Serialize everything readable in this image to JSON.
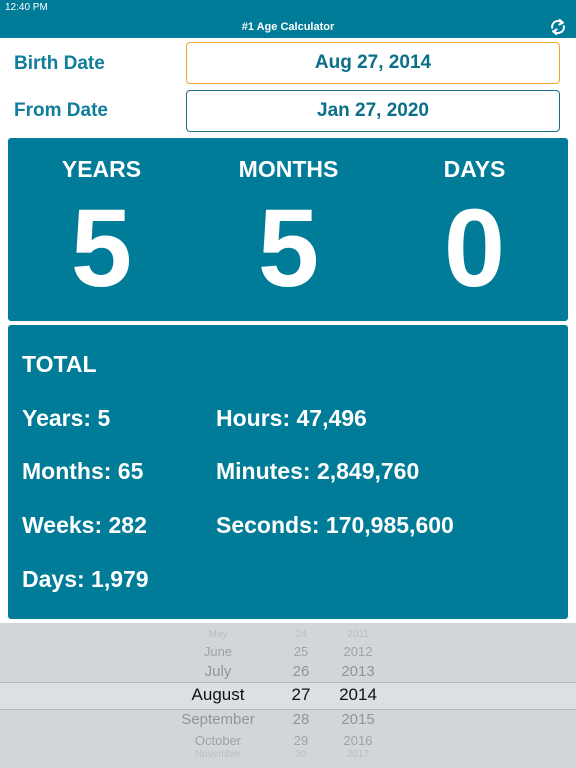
{
  "status_bar": {
    "time": "12:40 PM"
  },
  "nav": {
    "title": "#1 Age Calculator",
    "refresh_icon": "refresh-icon"
  },
  "birth": {
    "label": "Birth Date",
    "value": "Aug 27, 2014"
  },
  "from": {
    "label": "From Date",
    "value": "Jan 27, 2020"
  },
  "age": {
    "years_label": "YEARS",
    "years": "5",
    "months_label": "MONTHS",
    "months": "5",
    "days_label": "DAYS",
    "days": "0"
  },
  "total": {
    "title": "TOTAL",
    "years": "Years: 5",
    "months": "Months: 65",
    "weeks": "Weeks: 282",
    "days": "Days: 1,979",
    "hours": "Hours: 47,496",
    "minutes": "Minutes: 2,849,760",
    "seconds": "Seconds: 170,985,600"
  },
  "picker": {
    "months": [
      "May",
      "June",
      "July",
      "August",
      "September",
      "October",
      "November"
    ],
    "days": [
      "24",
      "25",
      "26",
      "27",
      "28",
      "29",
      "30"
    ],
    "years": [
      "2011",
      "2012",
      "2013",
      "2014",
      "2015",
      "2016",
      "2017"
    ],
    "selected_index": 3
  },
  "colors": {
    "accent": "#007c98",
    "birth_border": "#f0a82a",
    "from_border": "#1f6f88"
  }
}
